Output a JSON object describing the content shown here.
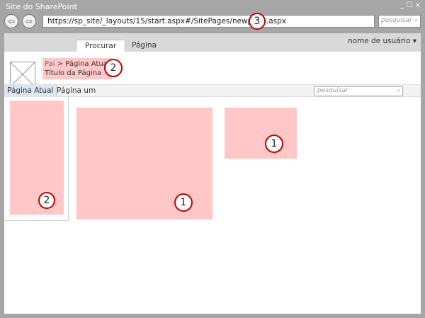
{
  "window": {
    "title": "Site do SharePoint",
    "controls": "_ ☐ ×"
  },
  "browser": {
    "back": "⇦",
    "forward": "⇨",
    "url": "https://sp_site/_layouts/15/start.aspx#/SitePages/newpage.aspx",
    "search_placeholder": "pesquisar"
  },
  "ribbon": {
    "tabs": [
      {
        "label": "Procurar"
      },
      {
        "label": "Página"
      }
    ],
    "user": "nome de usuário ▾"
  },
  "header": {
    "breadcrumb_parent": "Pai",
    "breadcrumb_sep": " > ",
    "breadcrumb_current": "Página Atual",
    "page_title": "Título da Página"
  },
  "quicknav": {
    "items": [
      {
        "label": "Página Atual"
      },
      {
        "label": "Página um"
      }
    ],
    "search_placeholder": "pesquisar"
  },
  "callouts": {
    "url": "3",
    "header": "2",
    "sidebar": "2",
    "main": "1",
    "side_zone": "1"
  },
  "colors": {
    "zone": "#ffc7c7",
    "callout": "#c00000"
  }
}
